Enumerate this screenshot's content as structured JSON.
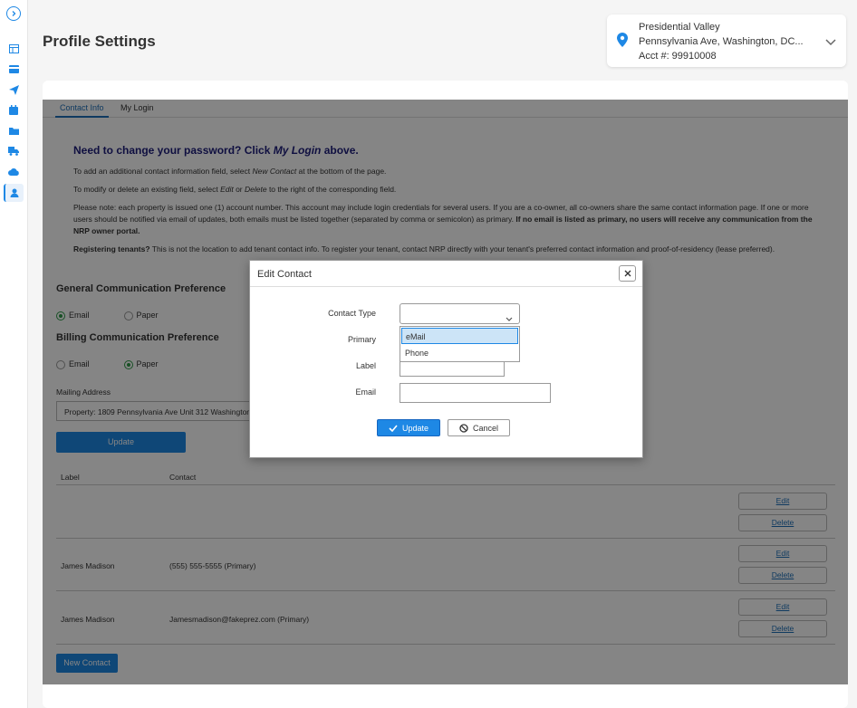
{
  "page": {
    "title": "Profile Settings"
  },
  "property": {
    "name": "Presidential Valley",
    "address": "Pennsylvania Ave, Washington, DC...",
    "account": "Acct #: 99910008"
  },
  "sidebar": {
    "items": [
      {
        "icon": "chevron-right-icon"
      },
      {
        "icon": "table-icon"
      },
      {
        "icon": "credit-card-icon"
      },
      {
        "icon": "send-icon"
      },
      {
        "icon": "calendar-icon"
      },
      {
        "icon": "folder-icon"
      },
      {
        "icon": "truck-icon"
      },
      {
        "icon": "cloud-icon"
      },
      {
        "icon": "user-icon"
      }
    ]
  },
  "tabs": [
    {
      "label": "Contact Info",
      "active": true
    },
    {
      "label": "My Login",
      "active": false
    }
  ],
  "info": {
    "heading_prefix": "Need to change your password?  Click ",
    "heading_link": "My Login",
    "heading_suffix": " above.",
    "add_prefix": "To add an additional contact information field, select ",
    "add_em": "New Contact",
    "add_suffix": " at the bottom of the page.",
    "modify_prefix": "To modify or delete an existing field, select ",
    "modify_em1": "Edit",
    "modify_or": " or ",
    "modify_em2": "Delete",
    "modify_suffix": " to the right of the corresponding field.",
    "note_text": "Please note: each property is issued one (1) account number. This account may include login credentials for several users. If you are a co-owner, all co-owners share the same contact information page. If one or more users should be notified via email of updates, both emails must be listed together (separated by comma or semicolon) as primary. ",
    "note_bold": "If no email is listed as primary, no users will receive any communication from the NRP owner portal.",
    "tenants_bold": "Registering tenants?",
    "tenants_text": " This is not the location to add tenant contact info. To register your tenant, contact NRP directly with your tenant's preferred contact information and proof-of-residency (lease preferred)."
  },
  "general_pref": {
    "title": "General Communication Preference",
    "options": [
      {
        "label": "Email",
        "checked": true
      },
      {
        "label": "Paper",
        "checked": false
      }
    ]
  },
  "billing_pref": {
    "title": "Billing Communication Preference",
    "options": [
      {
        "label": "Email",
        "checked": false
      },
      {
        "label": "Paper",
        "checked": true
      }
    ]
  },
  "mailing": {
    "label": "Mailing Address",
    "value": "Property: 1809 Pennsylvania Ave Unit 312 Washington",
    "update_label": "Update"
  },
  "contacts_table": {
    "headers": {
      "label": "Label",
      "contact": "Contact"
    },
    "rows": [
      {
        "label": "",
        "contact": "",
        "edit": "Edit",
        "delete": "Delete"
      },
      {
        "label": "James Madison",
        "contact": "(555) 555-5555 (Primary)",
        "edit": "Edit",
        "delete": "Delete"
      },
      {
        "label": "James Madison",
        "contact": "Jamesmadison@fakeprez.com (Primary)",
        "edit": "Edit",
        "delete": "Delete"
      }
    ],
    "new_contact_label": "New Contact"
  },
  "modal": {
    "title": "Edit Contact",
    "fields": {
      "contact_type": "Contact Type",
      "primary": "Primary",
      "label": "Label",
      "email": "Email"
    },
    "contact_type_value": "",
    "dropdown_options": [
      {
        "label": "eMail",
        "selected": true
      },
      {
        "label": "Phone",
        "selected": false
      }
    ],
    "update_label": "Update",
    "cancel_label": "Cancel"
  },
  "colors": {
    "accent": "#1e88e5",
    "heading_navy": "#1d1d7c",
    "radio_green": "#2e9a48",
    "overlay": "rgba(0,0,0,0.48)"
  }
}
